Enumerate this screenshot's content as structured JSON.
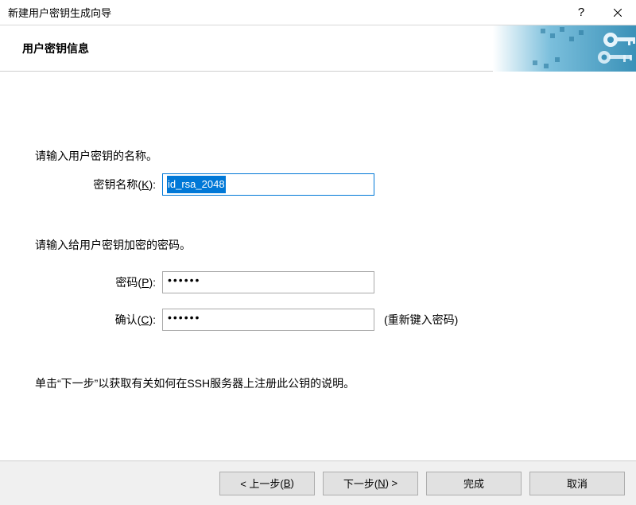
{
  "window": {
    "title": "新建用户密钥生成向导"
  },
  "banner": {
    "heading": "用户密钥信息"
  },
  "prompts": {
    "name_prompt": "请输入用户密钥的名称。",
    "password_prompt": "请输入给用户密钥加密的密码。",
    "next_instruction": "单击“下一步”以获取有关如何在SSH服务器上注册此公钥的说明。"
  },
  "fields": {
    "key_name": {
      "label_prefix": "密钥名称(",
      "hotkey": "K",
      "label_suffix": "):",
      "value": "id_rsa_2048"
    },
    "password": {
      "label_prefix": "密码(",
      "hotkey": "P",
      "label_suffix": "):",
      "value": "••••••"
    },
    "confirm": {
      "label_prefix": "确认(",
      "hotkey": "C",
      "label_suffix": "):",
      "value": "••••••",
      "hint": "(重新键入密码)"
    }
  },
  "buttons": {
    "back_prefix": "< 上一步(",
    "back_hotkey": "B",
    "back_suffix": ")",
    "next_prefix": "下一步(",
    "next_hotkey": "N",
    "next_suffix": ") >",
    "finish": "完成",
    "cancel": "取消"
  }
}
